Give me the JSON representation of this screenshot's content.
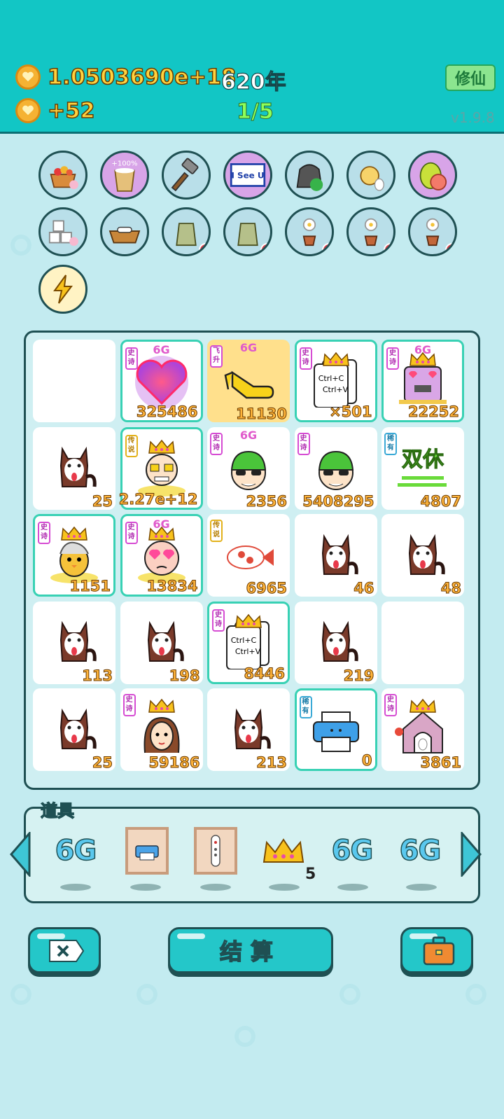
{
  "header": {
    "coins_total": "1.0503690e+18",
    "year": "620年",
    "xiuxian_label": "修仙",
    "coins_rate": "+52",
    "round": "1/5",
    "version": "v1.9.8",
    "coin_icon": "heart-coin-icon"
  },
  "skills": [
    {
      "name": "fruit-basket-icon"
    },
    {
      "name": "plus100-bucket-icon",
      "label": "+100%"
    },
    {
      "name": "hammer-icon"
    },
    {
      "name": "i-see-u-sign-icon",
      "label": "I See U"
    },
    {
      "name": "recycle-bag-icon"
    },
    {
      "name": "chick-egg-icon"
    },
    {
      "name": "pomelo-icon"
    },
    {
      "name": "sugar-cubes-icon"
    },
    {
      "name": "dog-bowl-icon"
    },
    {
      "name": "sack-icon-1"
    },
    {
      "name": "sack-icon-2"
    },
    {
      "name": "potted-flower-icon-1"
    },
    {
      "name": "potted-flower-icon-2"
    },
    {
      "name": "potted-flower-icon-3"
    },
    {
      "name": "lightning-icon"
    }
  ],
  "board": {
    "rows": [
      [
        {
          "empty": true
        },
        {
          "icon": "heart",
          "tag": "史诗",
          "g6": true,
          "count": "325486",
          "epic": true
        },
        {
          "icon": "pointing-hand",
          "tag": "飞升",
          "g6": true,
          "count": "11130",
          "yellow": true
        },
        {
          "icon": "ctrl-cv",
          "tag": "史诗",
          "crown": true,
          "count": "×501",
          "epic": true,
          "text1": "Ctrl+C",
          "text2": "Ctrl+V"
        },
        {
          "icon": "love-grumpy-face",
          "tag": "史诗",
          "g6": true,
          "crown": true,
          "count": "22252",
          "epic": true
        }
      ],
      [
        {
          "icon": "husky",
          "count": "25"
        },
        {
          "icon": "old-man",
          "tag": "传说",
          "crown": true,
          "count": "2.27e+12",
          "epic": true
        },
        {
          "icon": "green-hat-man",
          "tag": "史诗",
          "g6": true,
          "count": "2356"
        },
        {
          "icon": "green-hat-man",
          "tag": "史诗",
          "count": "5408295"
        },
        {
          "icon": "shuangxiu",
          "tag": "稀有",
          "count": "4807",
          "text1": "双休"
        }
      ],
      [
        {
          "icon": "grey-hair-chick",
          "tag": "史诗",
          "crown": true,
          "count": "1151",
          "epic": true
        },
        {
          "icon": "love-bald-man",
          "tag": "史诗",
          "g6": true,
          "crown": true,
          "count": "13834",
          "epic": true
        },
        {
          "icon": "koi-fish",
          "tag": "传说",
          "count": "6965"
        },
        {
          "icon": "husky",
          "count": "46"
        },
        {
          "icon": "husky",
          "count": "48"
        }
      ],
      [
        {
          "icon": "husky",
          "count": "113"
        },
        {
          "icon": "husky",
          "count": "198"
        },
        {
          "icon": "ctrl-cv",
          "tag": "史诗",
          "crown": true,
          "count": "8446",
          "epic": true,
          "text1": "Ctrl+C",
          "text2": "Ctrl+V"
        },
        {
          "icon": "husky",
          "count": "219"
        },
        {
          "empty": true
        }
      ],
      [
        {
          "icon": "husky",
          "count": "25"
        },
        {
          "icon": "girl",
          "tag": "史诗",
          "crown": true,
          "count": "59186"
        },
        {
          "icon": "husky",
          "count": "213"
        },
        {
          "icon": "printer",
          "tag": "稀有",
          "count": "0",
          "epic": true
        },
        {
          "icon": "rabbit-house",
          "tag": "史诗",
          "crown": true,
          "count": "3861"
        }
      ]
    ]
  },
  "items_bar": {
    "title": "道具",
    "g6_text": "6G",
    "crown_qty": "5",
    "items": [
      "6g-icon",
      "printer-frame-icon",
      "remote-frame-icon",
      "crown-icon",
      "6g-icon",
      "6g-icon"
    ]
  },
  "buttons": {
    "close_icon": "close-x-icon",
    "settle_label": "结算",
    "bag_icon": "briefcase-icon"
  },
  "colors": {
    "header": "#12c6c5",
    "accent": "#24c7c9",
    "coin": "#f5b233",
    "count": "#ffb43a"
  }
}
